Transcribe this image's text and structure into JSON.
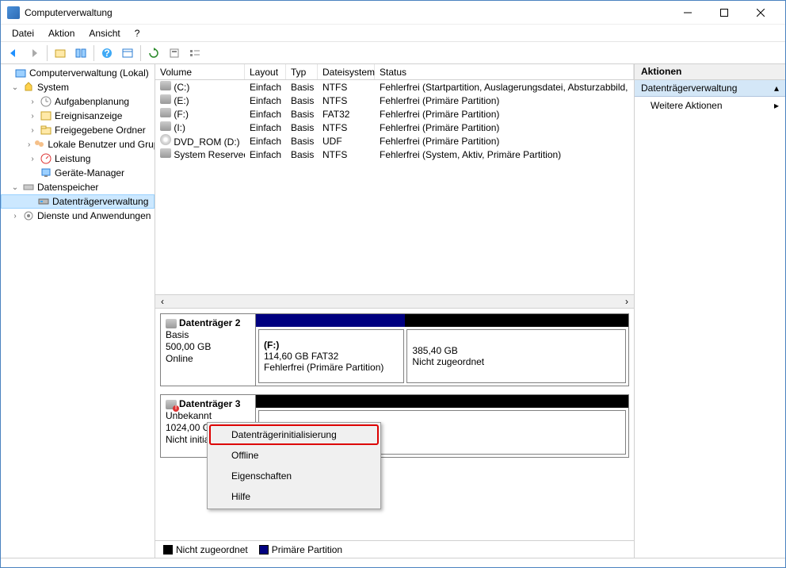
{
  "window": {
    "title": "Computerverwaltung"
  },
  "menu": {
    "items": [
      "Datei",
      "Aktion",
      "Ansicht",
      "?"
    ]
  },
  "tree": {
    "root": "Computerverwaltung (Lokal)",
    "system": "System",
    "children": {
      "aufgaben": "Aufgabenplanung",
      "ereignis": "Ereignisanzeige",
      "freigabe": "Freigegebene Ordner",
      "benutzer": "Lokale Benutzer und Gruppen",
      "leistung": "Leistung",
      "geraete": "Geräte-Manager"
    },
    "datenspeicher": "Datenspeicher",
    "diskmgmt": "Datenträgerverwaltung",
    "dienste": "Dienste und Anwendungen"
  },
  "columns": {
    "volume": "Volume",
    "layout": "Layout",
    "typ": "Typ",
    "fs": "Dateisystem",
    "status": "Status"
  },
  "volumes": [
    {
      "name": "(C:)",
      "layout": "Einfach",
      "typ": "Basis",
      "fs": "NTFS",
      "status": "Fehlerfrei (Startpartition, Auslagerungsdatei, Absturzabbild,",
      "icon": "disk"
    },
    {
      "name": "(E:)",
      "layout": "Einfach",
      "typ": "Basis",
      "fs": "NTFS",
      "status": "Fehlerfrei (Primäre Partition)",
      "icon": "disk"
    },
    {
      "name": "(F:)",
      "layout": "Einfach",
      "typ": "Basis",
      "fs": "FAT32",
      "status": "Fehlerfrei (Primäre Partition)",
      "icon": "disk"
    },
    {
      "name": "(I:)",
      "layout": "Einfach",
      "typ": "Basis",
      "fs": "NTFS",
      "status": "Fehlerfrei (Primäre Partition)",
      "icon": "disk"
    },
    {
      "name": "DVD_ROM (D:)",
      "layout": "Einfach",
      "typ": "Basis",
      "fs": "UDF",
      "status": "Fehlerfrei (Primäre Partition)",
      "icon": "cd"
    },
    {
      "name": "System Reserved",
      "layout": "Einfach",
      "typ": "Basis",
      "fs": "NTFS",
      "status": "Fehlerfrei (System, Aktiv, Primäre Partition)",
      "icon": "disk"
    }
  ],
  "disks": {
    "d2": {
      "name": "Datenträger 2",
      "type": "Basis",
      "size": "500,00 GB",
      "state": "Online",
      "parts": [
        {
          "label": "(F:)",
          "size": "114,60 GB FAT32",
          "status": "Fehlerfrei (Primäre Partition)",
          "color": "#000080",
          "width": "40%",
          "bold": true
        },
        {
          "label": "",
          "size": "385,40 GB",
          "status": "Nicht zugeordnet",
          "color": "#000",
          "width": "60%",
          "bold": false
        }
      ]
    },
    "d3": {
      "name": "Datenträger 3",
      "type": "Unbekannt",
      "size": "1024,00 GB",
      "state": "Nicht initialisiert"
    }
  },
  "legend": {
    "unalloc": "Nicht zugeordnet",
    "primary": "Primäre Partition"
  },
  "actions": {
    "header": "Aktionen",
    "section": "Datenträgerverwaltung",
    "more": "Weitere Aktionen"
  },
  "context": {
    "init": "Datenträgerinitialisierung",
    "offline": "Offline",
    "props": "Eigenschaften",
    "help": "Hilfe"
  }
}
